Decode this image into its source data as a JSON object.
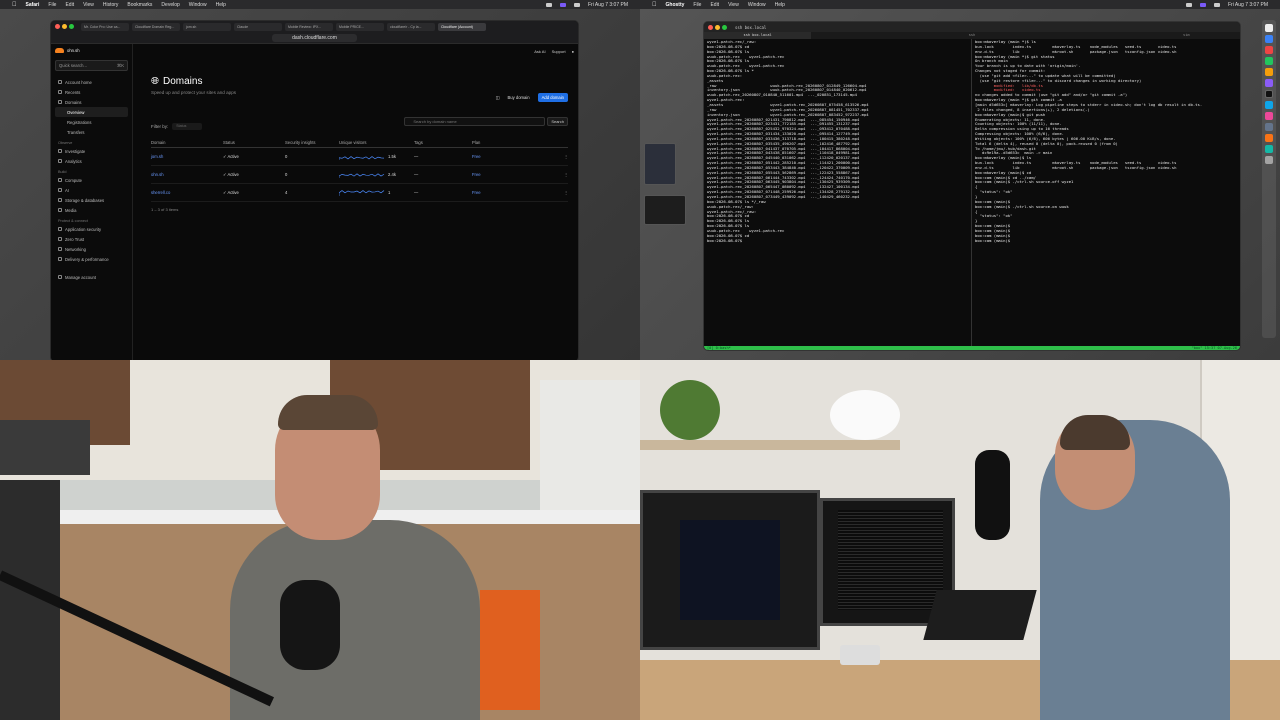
{
  "menubar_left": {
    "apple": "",
    "app": "Safari",
    "menus": [
      "File",
      "Edit",
      "View",
      "History",
      "Bookmarks",
      "Develop",
      "Window",
      "Help"
    ],
    "clock": "Fri Aug 7 3:07 PM"
  },
  "menubar_right": {
    "apple": "",
    "app": "Ghostty",
    "menus": [
      "File",
      "Edit",
      "View",
      "Window",
      "Help"
    ],
    "clock": "Fri Aug 7 3:07 PM"
  },
  "browser": {
    "tabs": [
      "Mr. Color Pro: Use ca...",
      "Cloudflare Domain Reg...",
      "jom.sh",
      "Claude",
      "Mobile Review: IPX...",
      "Mobile PRICE...",
      "cloudflare/r - Cp la...",
      "Cloudflare (Account)"
    ],
    "url": "dash.cloudflare.com"
  },
  "cloudflare": {
    "account": "ohn.sh",
    "search_placeholder": "Quick search...",
    "search_shortcut": "⌘K",
    "nav_top": [
      {
        "label": "Account home"
      },
      {
        "label": "Recents"
      },
      {
        "label": "Domains"
      }
    ],
    "nav_domains": [
      {
        "label": "Overview",
        "selected": true
      },
      {
        "label": "Registrations"
      },
      {
        "label": "Transfers"
      }
    ],
    "sec_observe": "Observe",
    "nav_observe": [
      {
        "label": "Investigate"
      },
      {
        "label": "Analytics"
      }
    ],
    "sec_build": "Build",
    "nav_build": [
      {
        "label": "Compute"
      },
      {
        "label": "AI"
      },
      {
        "label": "Storage & databases"
      },
      {
        "label": "Media"
      }
    ],
    "sec_protect": "Protect & connect",
    "nav_protect": [
      {
        "label": "Application security"
      },
      {
        "label": "Zero Trust"
      },
      {
        "label": "Networking"
      },
      {
        "label": "Delivery & performance"
      }
    ],
    "nav_bottom": "Manage account",
    "top_ask": "Ask AI",
    "top_support": "Support",
    "title": "Domains",
    "subtitle": "Speed up and protect your sites and apps",
    "buy": "Buy domain",
    "add": "Add domain",
    "search2_placeholder": "Search by domain name",
    "search2_btn": "Search",
    "filter_label": "Filter by:",
    "filter_value": "Status",
    "columns": [
      "Domain",
      "Status",
      "Security insights",
      "Unique visitors",
      "Tags",
      "Plan"
    ],
    "rows": [
      {
        "domain": "jom.sh",
        "status": "Active",
        "insights": "0",
        "visitors": "1.5k",
        "tags": "—",
        "plan": "Free",
        "level": 0.45
      },
      {
        "domain": "ohn.sh",
        "status": "Active",
        "insights": "0",
        "visitors": "2.4k",
        "tags": "—",
        "plan": "Free",
        "level": 0.6
      },
      {
        "domain": "sherrell.co",
        "status": "Active",
        "insights": "4",
        "visitors": "1",
        "tags": "—",
        "plan": "Free",
        "level": 0.85
      }
    ],
    "count": "1 – 3 of 3 items"
  },
  "terminal": {
    "title": "ssh box.local",
    "tabs": [
      "ssh box.local",
      "",
      "ssh",
      "",
      "vim"
    ],
    "left_lines": [
      "wyze1-patch-rec/_raw:",
      "box:2026-08-07$ cd",
      "box:2026-08-07$ ls",
      "wuuk-patch-rec    wyze1-patch-rec",
      "box:2026-08-07$ ls",
      "wuuk-patch-rec    wyze1-patch-rec",
      "box:2026-08-07$ ls *",
      "wuuk-patch-rec:",
      "_assets",
      "_raw                       wuuk-patch-rec_20260807_012849_126604.mp4",
      "inventory.json             wuuk-patch-rec_20260807_014840_020612.mp4",
      "wuuk-patch-rec_20260807_010840_511601.mp4  ..._020851_173145.mp4",
      "",
      "wyze1-patch-rec:",
      "_assets                    wyze1-patch-rec_20260807_075458_613526.mp4",
      "_raw                       wyze1-patch-rec_20260807_081451_702337.mp4",
      "inventory.json             wyze1-patch-rec_20260807_083452_972237.mp4",
      "wyze1-patch-rec_20260807_021431_790812.mp4  ..._085454_150946.mp4",
      "wyze1-patch-rec_20260807_023431_772185.mp4  ..._091455_131237.mp4",
      "wyze1-patch-rec_20260807_025432_970324.mp4  ..._093412_070488.mp4",
      "wyze1-patch-rec_20260807_031434_133020.mp4  ..._095414_127749.mp4",
      "wyze1-patch-rec_20260807_033436_313718.mp4  ..._100415_380248.mp4",
      "wyze1-patch-rec_20260807_035435_490207.mp4  ..._102416_487792.mp4",
      "wyze1-patch-rec_20260807_041437_070705.mp4  ..._104417_868004.mp4",
      "wyze1-patch-rec_20260807_043438_851607.mp4  ..._110418_049981.mp4",
      "wyze1-patch-rec_20260807_045440_031062.mp4  ..._112420_020137.mp4",
      "wyze1-patch-rec_20260807_051442_285210.mp4  ..._114421_200000.mp4",
      "wyze1-patch-rec_20260807_053443_384840.mp4  ..._120422_370009.mp4",
      "wyze1-patch-rec_20260807_055443_562869.mp4  ..._122423_558867.mp4",
      "wyze1-patch-rec_20260807_061444_743302.mp4  ..._124424_740170.mp4",
      "wyze1-patch-rec_20260807_063445_903804.mp4  ..._130425_939309.mp4",
      "wyze1-patch-rec_20260807_065447_080092.mp4  ..._132427_100134.mp4",
      "wyze1-patch-rec_20260807_071448_259926.mp4  ..._134428_279132.mp4",
      "wyze1-patch-rec_20260807_073449_439092.mp4  ..._140429_460232.mp4",
      "box:2026-08-07$ ls */_raw",
      "wuuk-patch-rec/_raw:",
      "",
      "wyze1-patch-rec/_raw:",
      "box:2026-08-07$ cd",
      "box:2026-08-07$ ls",
      "box:2026-08-07$ ls",
      "wuuk-patch-rec    wyze1-patch-rec",
      "box:2026-08-07$ cd",
      "box:2026-08-07$ "
    ],
    "right_lines": [
      "box:mkoverlay (main *)$ ls",
      "bun.lock        index.ts         mkoverlay.ts    node_modules   seed.ts       video.ts",
      "env.d.ts        lib              mkroot.sh       package.json   tsconfig.json video.sh",
      "box:mkoverlay (main *)$ git status",
      "On branch main",
      "Your branch is up to date with 'origin/main'.",
      "",
      "Changes not staged for commit:",
      "  (use \"git add <file>...\" to update what will be committed)",
      "  (use \"git restore <file>...\" to discard changes in working directory)",
      "        modified:   lib/db.ts",
      "        modified:   video.ts",
      "",
      "no changes added to commit (use \"git add\" and/or \"git commit -a\")",
      "box:mkoverlay (main *)$ git commit -a",
      "[main d5d653c] mkoverlay: Log pipeline steps to stderr in video.sh; don't log db result in db.ts.",
      " 2 files changed, 8 insertions(+), 2 deletions(-)",
      "box:mkoverlay (main)$ git push",
      "Enumerating objects: 11, done.",
      "Counting objects: 100% (11/11), done.",
      "Delta compression using up to 16 threads",
      "Compressing objects: 100% (6/6), done.",
      "Writing objects: 100% (6/6), 606 bytes | 606.00 KiB/s, done.",
      "Total 6 (delta 4), reused 0 (delta 0), pack-reused 0 (from 0)",
      "To /home/jmu/.hub/dash.git",
      "   dc9e19a..d5d653c  main -> main",
      "box:mkoverlay (main)$ ls",
      "bun.lock        index.ts         mkoverlay.ts    node_modules   seed.ts       video.ts",
      "env.d.ts        lib              mkroot.sh       package.json   tsconfig.json video.sh",
      "box:mkoverlay (main)$ cd",
      "box:cam (main)$ cd ../cam/",
      "box:cam (main)$ ./ctrl.sh source-off wyze1",
      "{",
      "  \"status\": \"ok\"",
      "}",
      "box:cam (main)$",
      "box:cam (main)$ ./ctrl.sh source-on wuuk",
      "{",
      "  \"status\": \"ok\"",
      "}",
      "box:cam (main)$",
      "box:cam (main)$",
      "box:cam (main)$",
      "box:cam (main)$"
    ],
    "status_left": "[0] 0:bash*",
    "status_right": "\"box\" 15:37 07-Aug-26"
  },
  "colors": {
    "accent": "#1f6fe5",
    "cf_orange": "#f6821f",
    "term_status": "#2fbf4a"
  }
}
